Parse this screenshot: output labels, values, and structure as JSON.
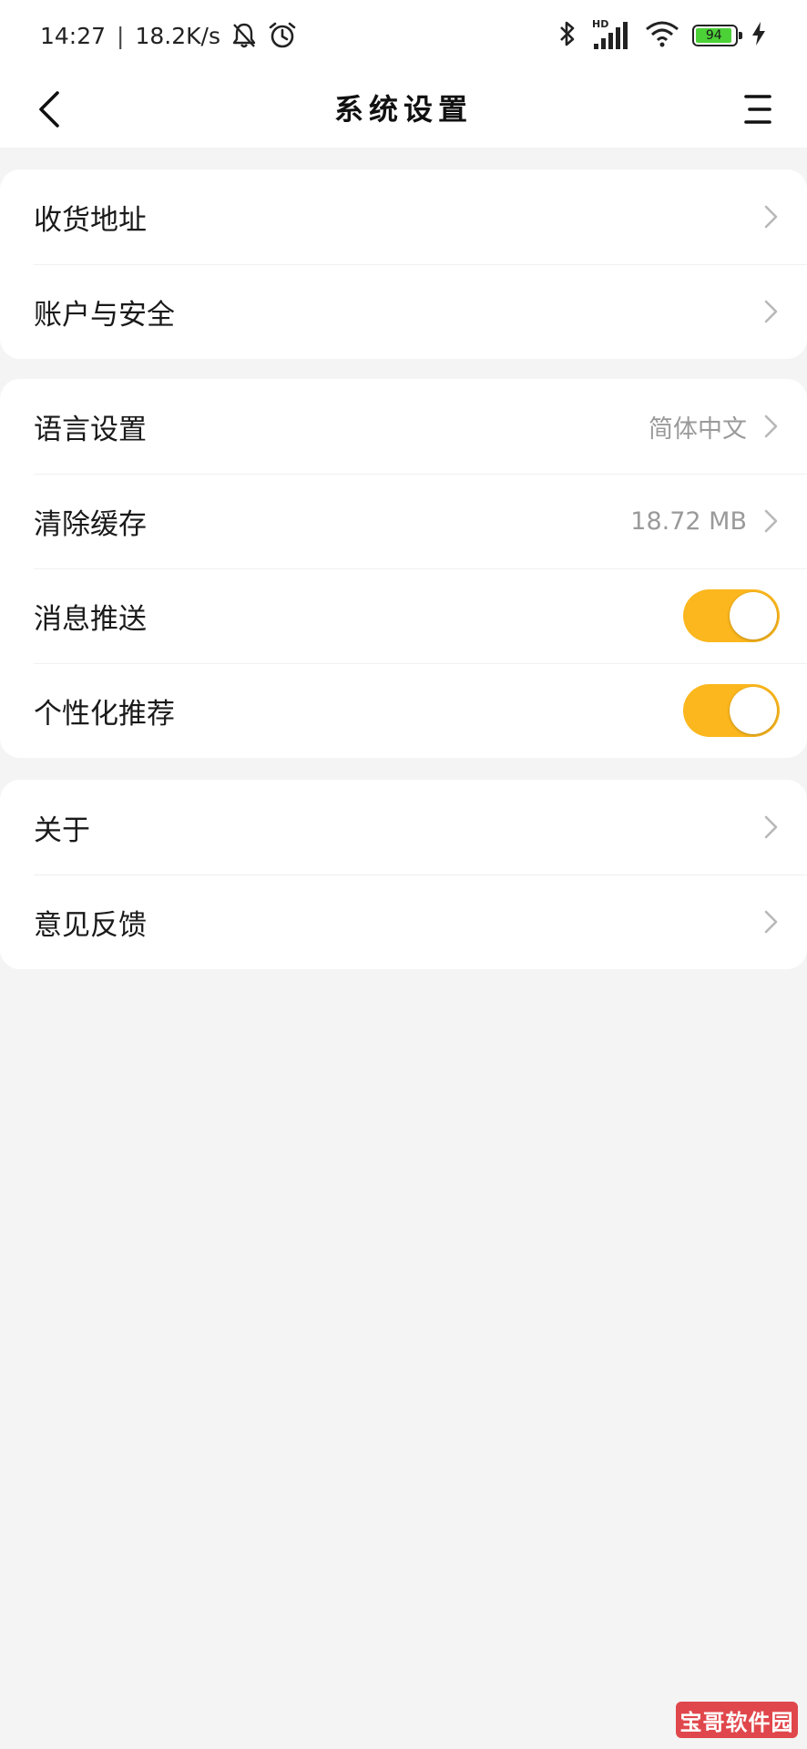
{
  "status_bar": {
    "time": "14:27",
    "separator": "|",
    "net_speed": "18.2K/s",
    "signal_label": "HD",
    "battery_level": "94",
    "battery_fill_color": "#4cd137",
    "icons": [
      "bell-off-icon",
      "alarm-icon",
      "bluetooth-icon",
      "signal-icon",
      "wifi-icon",
      "battery-icon",
      "charging-icon"
    ]
  },
  "header": {
    "title": "系统设置",
    "back_icon": "chevron-left-icon",
    "menu_icon": "menu-icon"
  },
  "groups": [
    {
      "items": [
        {
          "label": "收货地址",
          "type": "link"
        },
        {
          "label": "账户与安全",
          "type": "link"
        }
      ]
    },
    {
      "items": [
        {
          "label": "语言设置",
          "value": "简体中文",
          "type": "link"
        },
        {
          "label": "清除缓存",
          "value": "18.72 MB",
          "type": "link"
        },
        {
          "label": "消息推送",
          "type": "toggle",
          "on": true
        },
        {
          "label": "个性化推荐",
          "type": "toggle",
          "on": true
        }
      ]
    },
    {
      "items": [
        {
          "label": "关于",
          "type": "link"
        },
        {
          "label": "意见反馈",
          "type": "link"
        }
      ]
    }
  ],
  "colors": {
    "accent": "#fbb71d",
    "background": "#f4f4f4",
    "card": "#ffffff",
    "secondary_text": "#9a9a9a",
    "chevron": "#b8b8b8"
  },
  "watermark": {
    "text": "宝哥软件园"
  }
}
